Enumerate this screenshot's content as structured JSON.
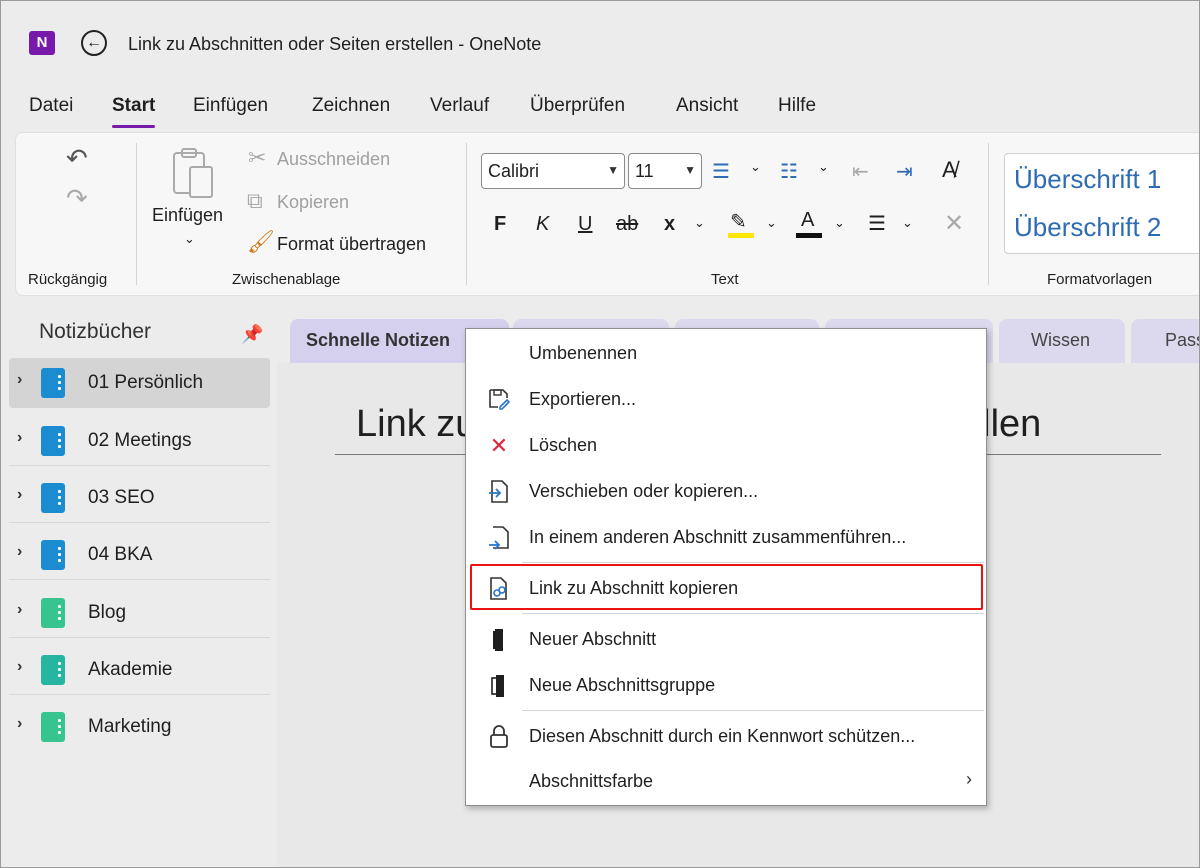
{
  "window": {
    "title": "Link zu Abschnitten oder Seiten erstellen  -  OneNote",
    "app_icon": "N"
  },
  "menu": {
    "tabs": [
      "Datei",
      "Start",
      "Einfügen",
      "Zeichnen",
      "Verlauf",
      "Überprüfen",
      "Ansicht",
      "Hilfe"
    ],
    "active": "Start"
  },
  "ribbon": {
    "undo_group": "Rückgängig",
    "clipboard": {
      "group": "Zwischenablage",
      "paste": "Einfügen",
      "cut": "Ausschneiden",
      "copy": "Kopieren",
      "format_painter": "Format übertragen"
    },
    "text": {
      "group": "Text",
      "font": "Calibri",
      "size": "11",
      "bold": "F",
      "italic": "K",
      "underline": "U",
      "strike": "ab",
      "subscript": "x"
    },
    "styles": {
      "group": "Formatvorlagen",
      "heading1": "Überschrift 1",
      "heading2": "Überschrift 2"
    }
  },
  "sidebar": {
    "header": "Notizbücher",
    "notebooks": [
      {
        "label": "01 Persönlich",
        "color": "#1b8ccf",
        "selected": true
      },
      {
        "label": "02 Meetings",
        "color": "#1b8ccf"
      },
      {
        "label": "03 SEO",
        "color": "#1b8ccf"
      },
      {
        "label": "04 BKA",
        "color": "#1b8ccf"
      },
      {
        "label": "Blog",
        "color": "#37c48e"
      },
      {
        "label": "Akademie",
        "color": "#26b5a0"
      },
      {
        "label": "Marketing",
        "color": "#37c48e"
      }
    ]
  },
  "section_tabs": {
    "active": "Schnelle Notizen",
    "wissen": "Wissen",
    "pass": "Pass"
  },
  "page": {
    "title_left": "Link zu",
    "title_right": "ellen"
  },
  "context_menu": {
    "items": [
      {
        "label": "Umbenennen",
        "icon": "none"
      },
      {
        "label": "Exportieren...",
        "icon": "export-icon"
      },
      {
        "label": "Löschen",
        "icon": "delete-x-icon"
      },
      {
        "label": "Verschieben oder kopieren...",
        "icon": "move-copy-icon"
      },
      {
        "label": "In einem anderen Abschnitt zusammenführen...",
        "icon": "merge-icon"
      },
      {
        "label": "Link zu Abschnitt kopieren",
        "icon": "copy-link-icon",
        "highlighted": true
      },
      {
        "label": "Neuer Abschnitt",
        "icon": "new-section-icon"
      },
      {
        "label": "Neue Abschnittsgruppe",
        "icon": "new-section-group-icon"
      },
      {
        "label": "Diesen Abschnitt durch ein Kennwort schützen...",
        "icon": "lock-icon"
      },
      {
        "label": "Abschnittsfarbe",
        "icon": "none",
        "submenu": true
      }
    ]
  },
  "colors": {
    "accent": "#7719aa",
    "highlight_border": "#e11111",
    "section_tab": "#dcd9ef"
  }
}
